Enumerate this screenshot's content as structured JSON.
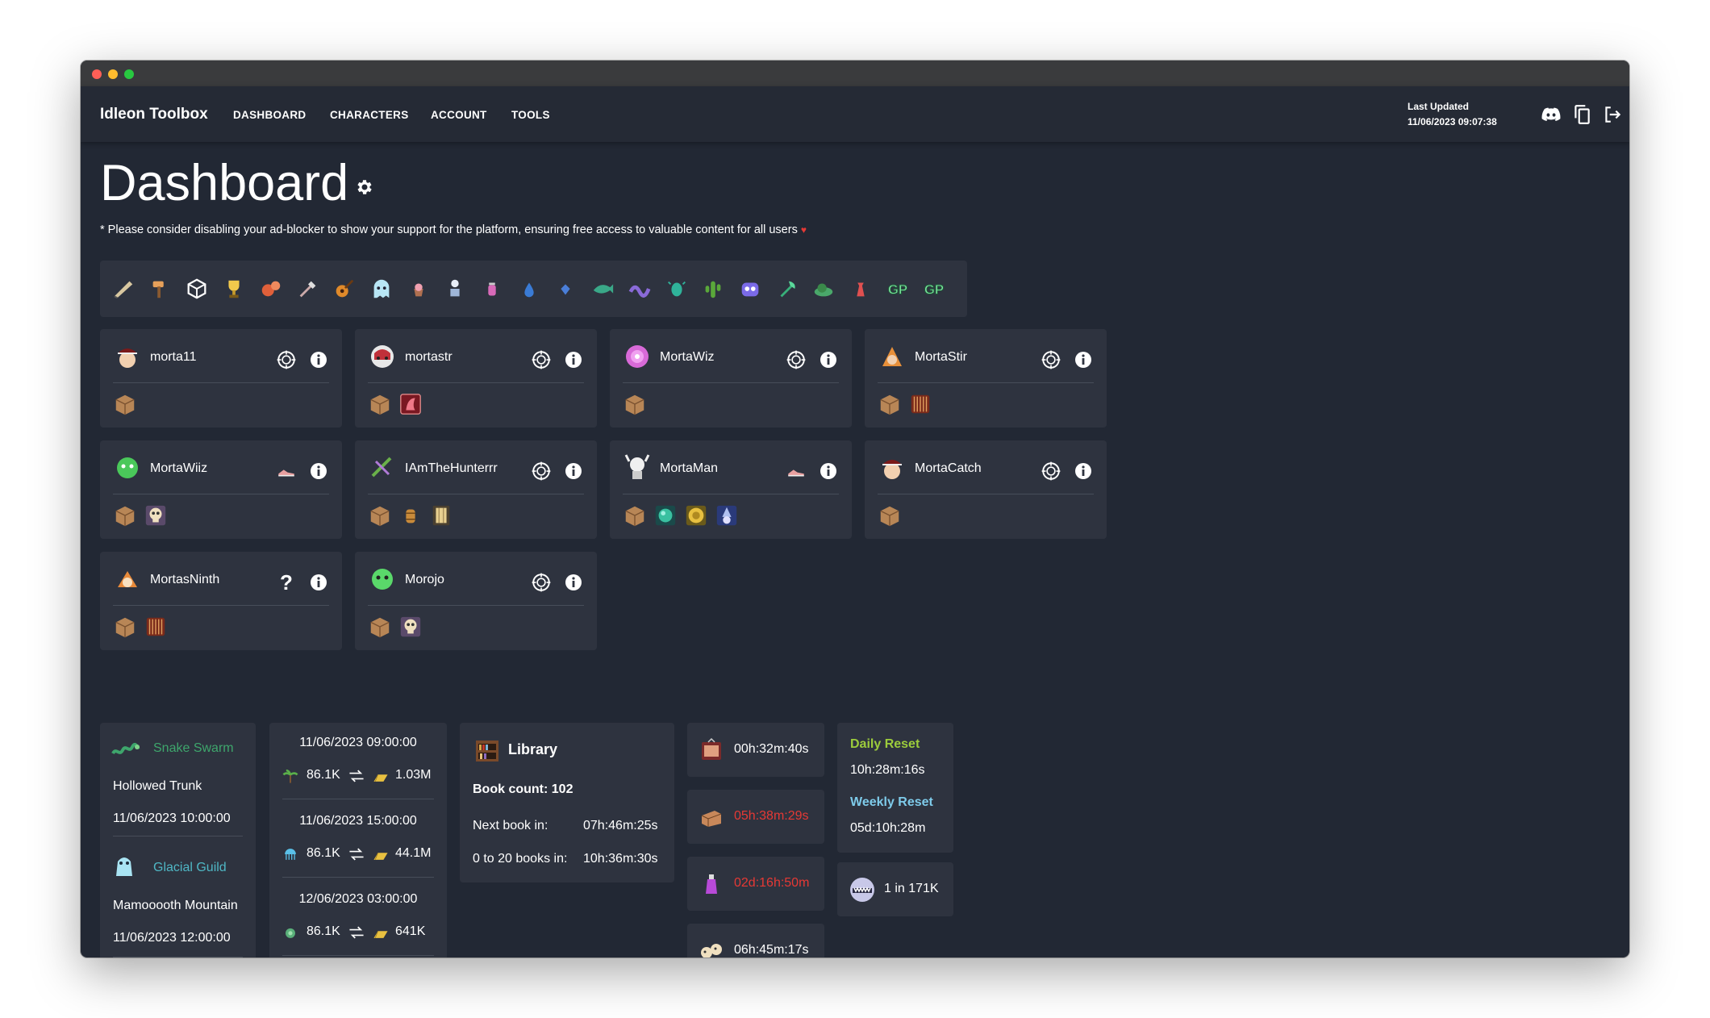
{
  "app": {
    "title": "Idleon Toolbox"
  },
  "nav": {
    "dashboard": "DASHBOARD",
    "characters": "CHARACTERS",
    "account": "ACCOUNT",
    "tools": "TOOLS"
  },
  "last_updated": {
    "label": "Last Updated",
    "value": "11/06/2023 09:07:38"
  },
  "page": {
    "title": "Dashboard",
    "notice": "* Please consider disabling your ad-blocker to show your support for the platform, ensuring free access to valuable content for all users",
    "heart": "♥"
  },
  "alert_icons": [
    "quill-icon",
    "hammer-icon",
    "cube-icon",
    "trophy-icon",
    "squirrel-icon",
    "shovel-icon",
    "guitar-icon",
    "ghost-icon",
    "cupcake-icon",
    "spirit-icon",
    "jar-icon",
    "drop-icon",
    "gem-icon",
    "whale-icon",
    "worm-icon",
    "beetle-icon",
    "cactus-icon",
    "monster-icon",
    "axe-icon",
    "snail-icon",
    "bottle-icon",
    "gp-icon",
    "gp-icon"
  ],
  "gp_text": "GP",
  "characters": [
    {
      "name": "morta11",
      "activity": "target-icon",
      "slots": [
        "crate-icon"
      ]
    },
    {
      "name": "mortastr",
      "activity": "target-icon",
      "slots": [
        "crate-icon",
        "shrine-icon"
      ]
    },
    {
      "name": "MortaWiz",
      "activity": "target-icon",
      "slots": [
        "crate-icon"
      ]
    },
    {
      "name": "MortaStir",
      "activity": "target-icon",
      "slots": [
        "crate-icon",
        "cage-icon"
      ]
    },
    {
      "name": "MortaWiiz",
      "activity": "sneaker-icon",
      "slots": [
        "crate-icon",
        "skull-icon"
      ]
    },
    {
      "name": "IAmTheHunterrr",
      "activity": "target-icon",
      "slots": [
        "crate-icon",
        "barrel-icon",
        "pillar-icon"
      ]
    },
    {
      "name": "MortaMan",
      "activity": "sneaker-icon",
      "slots": [
        "crate-icon",
        "orb-icon",
        "coin-icon",
        "wizard-icon"
      ]
    },
    {
      "name": "MortaCatch",
      "activity": "target-icon",
      "slots": [
        "crate-icon"
      ]
    },
    {
      "name": "MortasNinth",
      "activity": "question-icon",
      "slots": [
        "crate-icon",
        "cage-icon"
      ]
    },
    {
      "name": "Morojo",
      "activity": "target-icon",
      "slots": [
        "crate-icon",
        "skull-icon"
      ]
    }
  ],
  "question_mark": "?",
  "bosses": [
    {
      "name": "Snake Swarm",
      "location": "Hollowed Trunk",
      "time": "11/06/2023 10:00:00"
    },
    {
      "name": "Glacial Guild",
      "location": "Mamooooth Mountain",
      "time": "11/06/2023 12:00:00"
    }
  ],
  "trades": [
    {
      "time": "11/06/2023 09:00:00",
      "amount": "86.1K",
      "reward": "1.03M"
    },
    {
      "time": "11/06/2023 15:00:00",
      "amount": "86.1K",
      "reward": "44.1M"
    },
    {
      "time": "12/06/2023 03:00:00",
      "amount": "86.1K",
      "reward": "641K"
    }
  ],
  "library": {
    "title": "Library",
    "book_count": "Book count: 102",
    "next_label": "Next book in:",
    "next_value": "07h:46m:25s",
    "twenty_label": "0 to 20 books in:",
    "twenty_value": "10h:36m:30s"
  },
  "timers": [
    {
      "icon": "tv-icon",
      "value": "00h:32m:40s",
      "color": "#ffffff"
    },
    {
      "icon": "chest-icon",
      "value": "05h:38m:29s",
      "color": "#e53935"
    },
    {
      "icon": "potion-icon",
      "value": "02d:16h:50m",
      "color": "#e53935"
    },
    {
      "icon": "critters-icon",
      "value": "06h:45m:17s",
      "color": "#ffffff"
    }
  ],
  "resets": {
    "daily_label": "Daily Reset",
    "daily_value": "10h:28m:16s",
    "weekly_label": "Weekly Reset",
    "weekly_value": "05d:10h:28m"
  },
  "odds": {
    "value": "1 in 171K"
  },
  "colors": {
    "window_bg": "#222834",
    "card_bg": "#2e333f",
    "daily": "#9ccc3c",
    "weekly": "#7ecbea",
    "alert": "#e53935"
  }
}
